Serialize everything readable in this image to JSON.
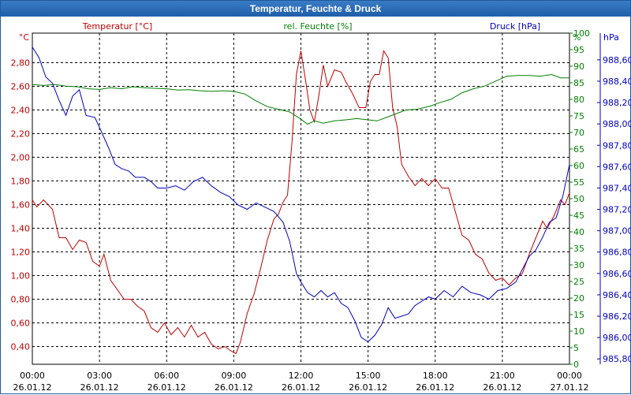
{
  "window": {
    "title": "Temperatur, Feuchte & Druck"
  },
  "colors": {
    "temperature": "#c00000",
    "humidity": "#008000",
    "pressure": "#0000c0",
    "grid": "#000000"
  },
  "chart_data": {
    "type": "line",
    "title": "Temperatur, Feuchte & Druck",
    "grid": true,
    "x_ticks": [
      {
        "time": "00:00",
        "date": "26.01.12"
      },
      {
        "time": "03:00",
        "date": "26.01.12"
      },
      {
        "time": "06:00",
        "date": "26.01.12"
      },
      {
        "time": "09:00",
        "date": "26.01.12"
      },
      {
        "time": "12:00",
        "date": "26.01.12"
      },
      {
        "time": "15:00",
        "date": "26.01.12"
      },
      {
        "time": "18:00",
        "date": "26.01.12"
      },
      {
        "time": "21:00",
        "date": "26.01.12"
      },
      {
        "time": "00:00",
        "date": "27.01.12"
      }
    ],
    "xlim": [
      0,
      24
    ],
    "axes": {
      "temperature": {
        "label": "Temperatur [°C]",
        "unit": "°C",
        "ylim": [
          0.25,
          3.05
        ],
        "ticks": [
          "0,40",
          "0,60",
          "0,80",
          "1,00",
          "1,20",
          "1,40",
          "1,60",
          "1,80",
          "2,00",
          "2,20",
          "2,40",
          "2,60",
          "2,80"
        ]
      },
      "humidity": {
        "label": "rel. Feuchte [%]",
        "unit": "%",
        "ylim": [
          0,
          100
        ],
        "ticks": [
          "0",
          "5",
          "10",
          "15",
          "20",
          "25",
          "30",
          "35",
          "40",
          "45",
          "50",
          "55",
          "60",
          "65",
          "70",
          "75",
          "80",
          "85",
          "90",
          "95",
          "100"
        ]
      },
      "pressure": {
        "label": "Druck [hPa]",
        "unit": "hPa",
        "ylim": [
          985.75,
          988.85
        ],
        "ticks": [
          "985,80",
          "986,00",
          "986,20",
          "986,40",
          "986,60",
          "986,80",
          "987,00",
          "987,20",
          "987,40",
          "987,60",
          "987,80",
          "988,00",
          "988,20",
          "988,40",
          "988,60"
        ]
      }
    },
    "series": [
      {
        "name": "Temperatur [°C]",
        "axis": "temperature",
        "points": [
          [
            0,
            1.64
          ],
          [
            0.2,
            1.58
          ],
          [
            0.5,
            1.64
          ],
          [
            0.9,
            1.56
          ],
          [
            1.2,
            1.32
          ],
          [
            1.5,
            1.32
          ],
          [
            1.8,
            1.22
          ],
          [
            2.1,
            1.3
          ],
          [
            2.4,
            1.28
          ],
          [
            2.7,
            1.12
          ],
          [
            3.0,
            1.08
          ],
          [
            3.2,
            1.18
          ],
          [
            3.5,
            0.96
          ],
          [
            3.8,
            0.88
          ],
          [
            4.1,
            0.8
          ],
          [
            4.4,
            0.8
          ],
          [
            4.7,
            0.74
          ],
          [
            5.0,
            0.7
          ],
          [
            5.3,
            0.56
          ],
          [
            5.6,
            0.52
          ],
          [
            5.9,
            0.6
          ],
          [
            6.2,
            0.5
          ],
          [
            6.5,
            0.56
          ],
          [
            6.8,
            0.48
          ],
          [
            7.1,
            0.58
          ],
          [
            7.4,
            0.48
          ],
          [
            7.7,
            0.52
          ],
          [
            8.0,
            0.42
          ],
          [
            8.3,
            0.38
          ],
          [
            8.6,
            0.4
          ],
          [
            8.9,
            0.36
          ],
          [
            9.1,
            0.34
          ],
          [
            9.3,
            0.44
          ],
          [
            9.6,
            0.68
          ],
          [
            9.9,
            0.84
          ],
          [
            10.2,
            1.06
          ],
          [
            10.5,
            1.3
          ],
          [
            10.8,
            1.48
          ],
          [
            11.0,
            1.52
          ],
          [
            11.2,
            1.62
          ],
          [
            11.4,
            1.68
          ],
          [
            11.6,
            2.12
          ],
          [
            11.8,
            2.7
          ],
          [
            12.0,
            2.9
          ],
          [
            12.2,
            2.66
          ],
          [
            12.4,
            2.4
          ],
          [
            12.6,
            2.3
          ],
          [
            12.8,
            2.52
          ],
          [
            13.0,
            2.78
          ],
          [
            13.2,
            2.6
          ],
          [
            13.5,
            2.74
          ],
          [
            13.8,
            2.72
          ],
          [
            14.0,
            2.64
          ],
          [
            14.3,
            2.54
          ],
          [
            14.6,
            2.42
          ],
          [
            14.9,
            2.42
          ],
          [
            15.1,
            2.64
          ],
          [
            15.3,
            2.7
          ],
          [
            15.5,
            2.7
          ],
          [
            15.7,
            2.9
          ],
          [
            15.9,
            2.84
          ],
          [
            16.1,
            2.42
          ],
          [
            16.3,
            2.26
          ],
          [
            16.5,
            1.94
          ],
          [
            16.8,
            1.84
          ],
          [
            17.1,
            1.76
          ],
          [
            17.4,
            1.82
          ],
          [
            17.7,
            1.76
          ],
          [
            18.0,
            1.82
          ],
          [
            18.3,
            1.74
          ],
          [
            18.6,
            1.74
          ],
          [
            18.9,
            1.54
          ],
          [
            19.2,
            1.34
          ],
          [
            19.5,
            1.3
          ],
          [
            19.8,
            1.18
          ],
          [
            20.1,
            1.14
          ],
          [
            20.4,
            1.02
          ],
          [
            20.7,
            0.96
          ],
          [
            21.0,
            0.98
          ],
          [
            21.3,
            0.92
          ],
          [
            21.6,
            0.98
          ],
          [
            21.9,
            1.02
          ],
          [
            22.2,
            1.18
          ],
          [
            22.5,
            1.32
          ],
          [
            22.8,
            1.46
          ],
          [
            23.0,
            1.4
          ],
          [
            23.3,
            1.5
          ],
          [
            23.6,
            1.64
          ],
          [
            23.8,
            1.6
          ],
          [
            24.0,
            1.7
          ]
        ]
      },
      {
        "name": "rel. Feuchte [%]",
        "axis": "humidity",
        "points": [
          [
            0,
            84.5
          ],
          [
            0.5,
            84.2
          ],
          [
            1,
            84.5
          ],
          [
            1.5,
            84.0
          ],
          [
            2,
            83.8
          ],
          [
            2.5,
            83.2
          ],
          [
            3,
            83.0
          ],
          [
            3.5,
            83.5
          ],
          [
            4,
            83.2
          ],
          [
            4.5,
            83.8
          ],
          [
            5,
            83.5
          ],
          [
            5.5,
            83.3
          ],
          [
            6,
            83.2
          ],
          [
            6.5,
            82.8
          ],
          [
            7,
            82.9
          ],
          [
            7.5,
            82.6
          ],
          [
            8,
            82.4
          ],
          [
            8.5,
            82.6
          ],
          [
            9,
            82.4
          ],
          [
            9.5,
            81.6
          ],
          [
            10,
            79.5
          ],
          [
            10.5,
            77.8
          ],
          [
            11,
            77.0
          ],
          [
            11.5,
            76.2
          ],
          [
            12,
            74.0
          ],
          [
            12.3,
            72.5
          ],
          [
            12.6,
            73.5
          ],
          [
            13,
            72.8
          ],
          [
            13.5,
            73.5
          ],
          [
            14,
            73.8
          ],
          [
            14.5,
            74.2
          ],
          [
            15,
            73.8
          ],
          [
            15.4,
            73.5
          ],
          [
            15.8,
            74.5
          ],
          [
            16.2,
            75.5
          ],
          [
            16.7,
            76.8
          ],
          [
            17.2,
            77.0
          ],
          [
            17.8,
            78.0
          ],
          [
            18.2,
            79.0
          ],
          [
            18.7,
            80.0
          ],
          [
            19.2,
            82.0
          ],
          [
            19.7,
            83.2
          ],
          [
            20.2,
            84.0
          ],
          [
            20.7,
            85.5
          ],
          [
            21.2,
            87.0
          ],
          [
            21.7,
            87.2
          ],
          [
            22.2,
            87.2
          ],
          [
            22.7,
            87.0
          ],
          [
            23.2,
            87.5
          ],
          [
            23.6,
            86.5
          ],
          [
            24,
            86.5
          ]
        ]
      },
      {
        "name": "Druck [hPa]",
        "axis": "pressure",
        "points": [
          [
            0,
            988.72
          ],
          [
            0.3,
            988.62
          ],
          [
            0.6,
            988.44
          ],
          [
            0.9,
            988.38
          ],
          [
            1.2,
            988.22
          ],
          [
            1.5,
            988.08
          ],
          [
            1.8,
            988.26
          ],
          [
            2.1,
            988.32
          ],
          [
            2.4,
            988.08
          ],
          [
            2.8,
            988.06
          ],
          [
            3.1,
            987.92
          ],
          [
            3.4,
            987.78
          ],
          [
            3.7,
            987.62
          ],
          [
            4.0,
            987.58
          ],
          [
            4.3,
            987.56
          ],
          [
            4.6,
            987.5
          ],
          [
            5.0,
            987.5
          ],
          [
            5.3,
            987.46
          ],
          [
            5.6,
            987.4
          ],
          [
            6.0,
            987.4
          ],
          [
            6.4,
            987.42
          ],
          [
            6.8,
            987.38
          ],
          [
            7.2,
            987.46
          ],
          [
            7.6,
            987.5
          ],
          [
            8.0,
            987.42
          ],
          [
            8.4,
            987.36
          ],
          [
            8.8,
            987.32
          ],
          [
            9.2,
            987.24
          ],
          [
            9.6,
            987.2
          ],
          [
            10.0,
            987.26
          ],
          [
            10.4,
            987.22
          ],
          [
            10.8,
            987.18
          ],
          [
            11.2,
            987.08
          ],
          [
            11.5,
            986.9
          ],
          [
            11.8,
            986.6
          ],
          [
            12.0,
            986.52
          ],
          [
            12.3,
            986.42
          ],
          [
            12.6,
            986.38
          ],
          [
            12.9,
            986.44
          ],
          [
            13.2,
            986.38
          ],
          [
            13.5,
            986.42
          ],
          [
            13.8,
            986.32
          ],
          [
            14.1,
            986.28
          ],
          [
            14.4,
            986.16
          ],
          [
            14.7,
            986.0
          ],
          [
            15.0,
            985.96
          ],
          [
            15.3,
            986.02
          ],
          [
            15.6,
            986.12
          ],
          [
            15.9,
            986.28
          ],
          [
            16.2,
            986.18
          ],
          [
            16.5,
            986.2
          ],
          [
            16.8,
            986.22
          ],
          [
            17.1,
            986.3
          ],
          [
            17.4,
            986.34
          ],
          [
            17.7,
            986.38
          ],
          [
            18.0,
            986.36
          ],
          [
            18.4,
            986.44
          ],
          [
            18.8,
            986.38
          ],
          [
            19.2,
            986.48
          ],
          [
            19.6,
            986.42
          ],
          [
            20.0,
            986.4
          ],
          [
            20.4,
            986.36
          ],
          [
            20.8,
            986.44
          ],
          [
            21.2,
            986.46
          ],
          [
            21.6,
            986.52
          ],
          [
            21.9,
            986.64
          ],
          [
            22.2,
            986.76
          ],
          [
            22.5,
            986.82
          ],
          [
            22.8,
            986.94
          ],
          [
            23.1,
            987.08
          ],
          [
            23.4,
            987.12
          ],
          [
            23.7,
            987.32
          ],
          [
            24.0,
            987.62
          ]
        ]
      }
    ]
  }
}
